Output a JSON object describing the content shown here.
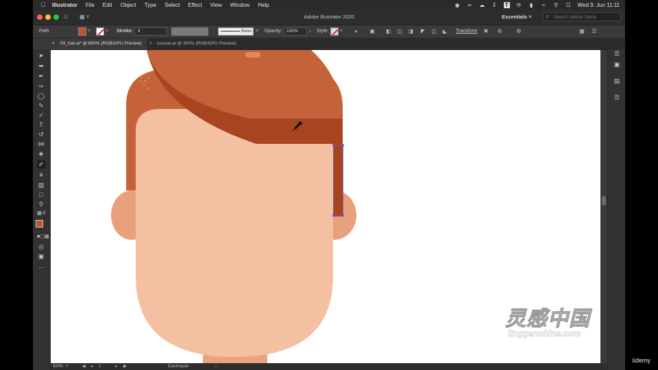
{
  "menubar": {
    "app_name": "Illustrator",
    "items": [
      "File",
      "Edit",
      "Object",
      "Type",
      "Select",
      "Effect",
      "View",
      "Window",
      "Help"
    ],
    "clock": "Wed 9. Jun  11:11"
  },
  "titlebar": {
    "title": "Adobe Illustrator 2020",
    "workspace": "Essentials",
    "search_placeholder": "Search Adobe Stock"
  },
  "controlbar": {
    "selection_type": "Path",
    "stroke_label": "Stroke:",
    "brush_label": "Basic",
    "opacity_label": "Opacity:",
    "opacity_value": "100%",
    "style_label": "Style:",
    "transform_label": "Transform"
  },
  "tabs": [
    {
      "label": "03_hair.ai* @ 800% (RGB/GPU Preview)",
      "active": true
    },
    {
      "label": "coursei.ai @ 300% (RGB/GPU Preview)",
      "active": false
    }
  ],
  "statusbar": {
    "zoom": "800%",
    "artboard": "1",
    "tool_name": "Eyedropper"
  },
  "colors": {
    "fill": "#c2512c",
    "hair_main": "#c4623a",
    "hair_dark": "#a8441f",
    "skin": "#f4c0a2",
    "ear": "#e8a07c",
    "neck": "#eaa27f",
    "selection": "#5c5ccc"
  },
  "watermark": {
    "chinese": "灵感中国",
    "english": "lingganchina.com"
  },
  "brand": "ūdemy"
}
